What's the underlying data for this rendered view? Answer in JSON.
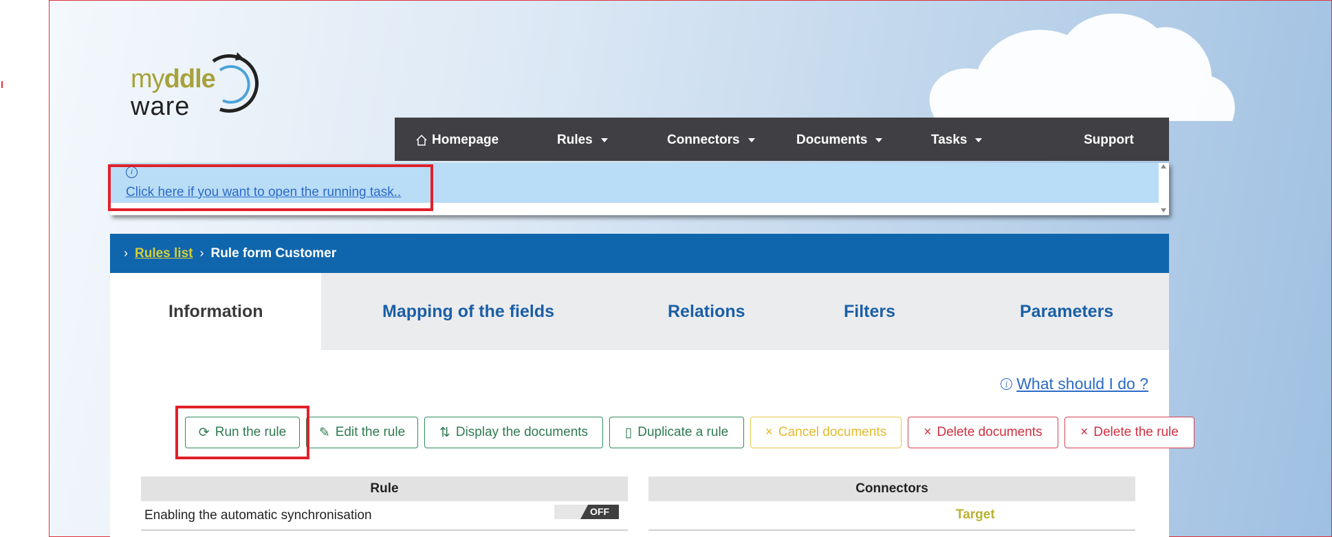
{
  "logo": {
    "part1": "my",
    "part2": "ddle",
    "part3": "ware"
  },
  "nav": {
    "homepage": "Homepage",
    "rules": "Rules",
    "connectors": "Connectors",
    "documents": "Documents",
    "tasks": "Tasks",
    "support": "Support"
  },
  "notice": {
    "link_text": "Click here if you want to open the running task.."
  },
  "breadcrumb": {
    "link": "Rules list",
    "current": "Rule form Customer"
  },
  "tabs": [
    "Information",
    "Mapping of the fields",
    "Relations",
    "Filters",
    "Parameters"
  ],
  "help": {
    "text": "What should I do ?"
  },
  "buttons": {
    "run": "Run the rule",
    "edit": "Edit the rule",
    "display": "Display the documents",
    "duplicate": "Duplicate a rule",
    "cancel": "Cancel documents",
    "delete_docs": "Delete documents",
    "delete_rule": "Delete the rule"
  },
  "rule_table": {
    "header": "Rule",
    "row_label": "Enabling the automatic synchronisation",
    "toggle_state": "OFF"
  },
  "connectors_table": {
    "header": "Connectors",
    "target": "Target"
  },
  "colors": {
    "navbar": "#403f43",
    "breadcrumb": "#1066ac",
    "accent": "#d4cf3a",
    "highlight": "#e0202a"
  }
}
